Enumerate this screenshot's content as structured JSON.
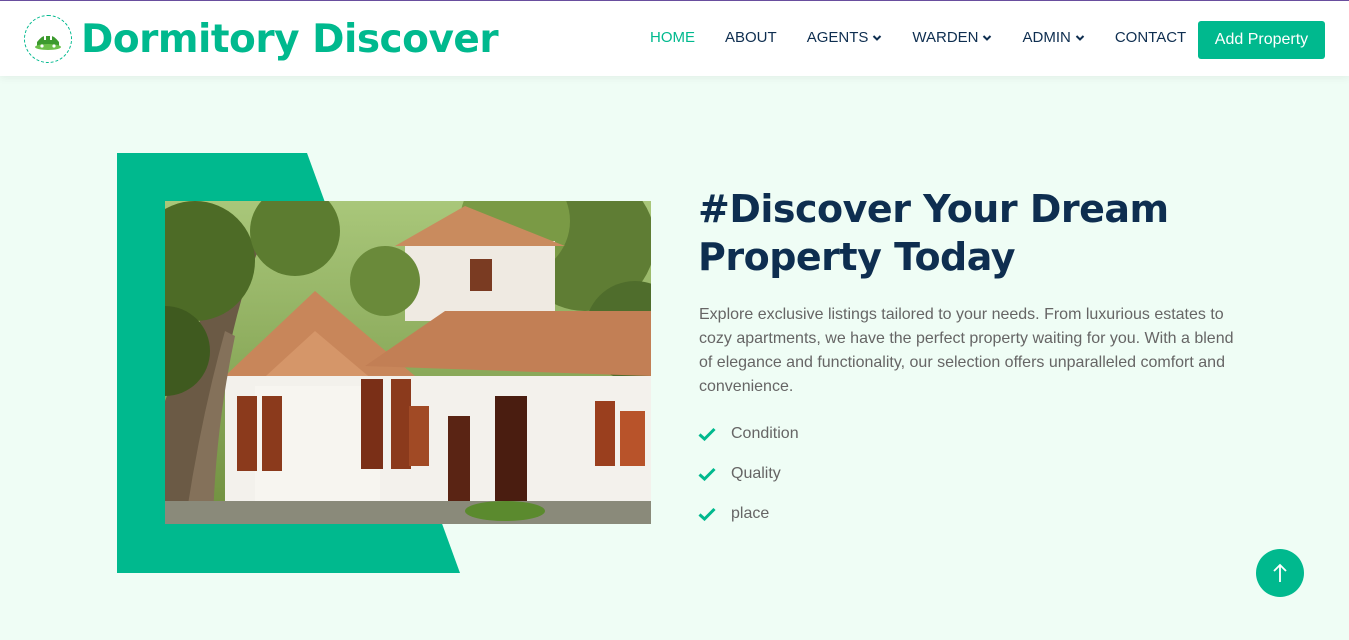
{
  "brand": {
    "name": "Dormitory Discover",
    "logo_icon": "house-logo-icon"
  },
  "nav": {
    "items": [
      {
        "label": "HOME",
        "active": true
      },
      {
        "label": "ABOUT"
      },
      {
        "label": "AGENTS",
        "dropdown": true
      },
      {
        "label": "WARDEN",
        "dropdown": true
      },
      {
        "label": "ADMIN",
        "dropdown": true
      },
      {
        "label": "CONTACT"
      }
    ],
    "add_property_label": "Add Property"
  },
  "hero": {
    "headline": "#Discover Your Dream Property Today",
    "description": "Explore exclusive listings tailored to your needs. From luxurious estates to cozy apartments, we have the perfect property waiting for you. With a blend of elegance and functionality, our selection offers unparalleled comfort and convenience.",
    "features": [
      "Condition",
      "Quality",
      "place"
    ],
    "image_icon": "house-photo"
  },
  "colors": {
    "accent": "#00b98e",
    "dark": "#0e2e50",
    "background": "#effdf5",
    "text": "#666565"
  },
  "back_to_top_icon": "arrow-up-icon"
}
